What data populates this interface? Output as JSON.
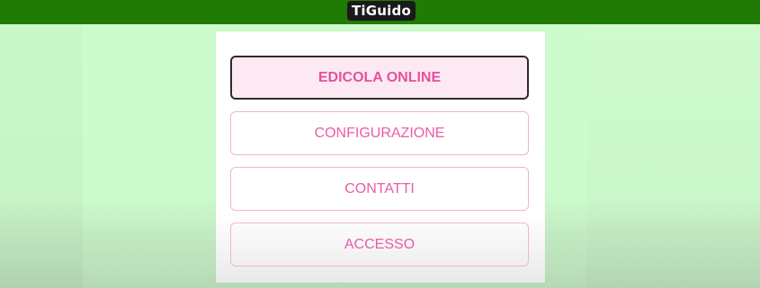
{
  "header": {
    "logo_text": "TiGuido",
    "bar_color": "#1f7a06"
  },
  "menu": {
    "items": [
      {
        "label": "EDICOLA ONLINE",
        "active": true
      },
      {
        "label": "CONFIGURAZIONE",
        "active": false
      },
      {
        "label": "CONTATTI",
        "active": false
      },
      {
        "label": "ACCESSO",
        "active": false
      }
    ]
  },
  "colors": {
    "accent": "#ea5ca6",
    "background": "#ccfbcc"
  }
}
